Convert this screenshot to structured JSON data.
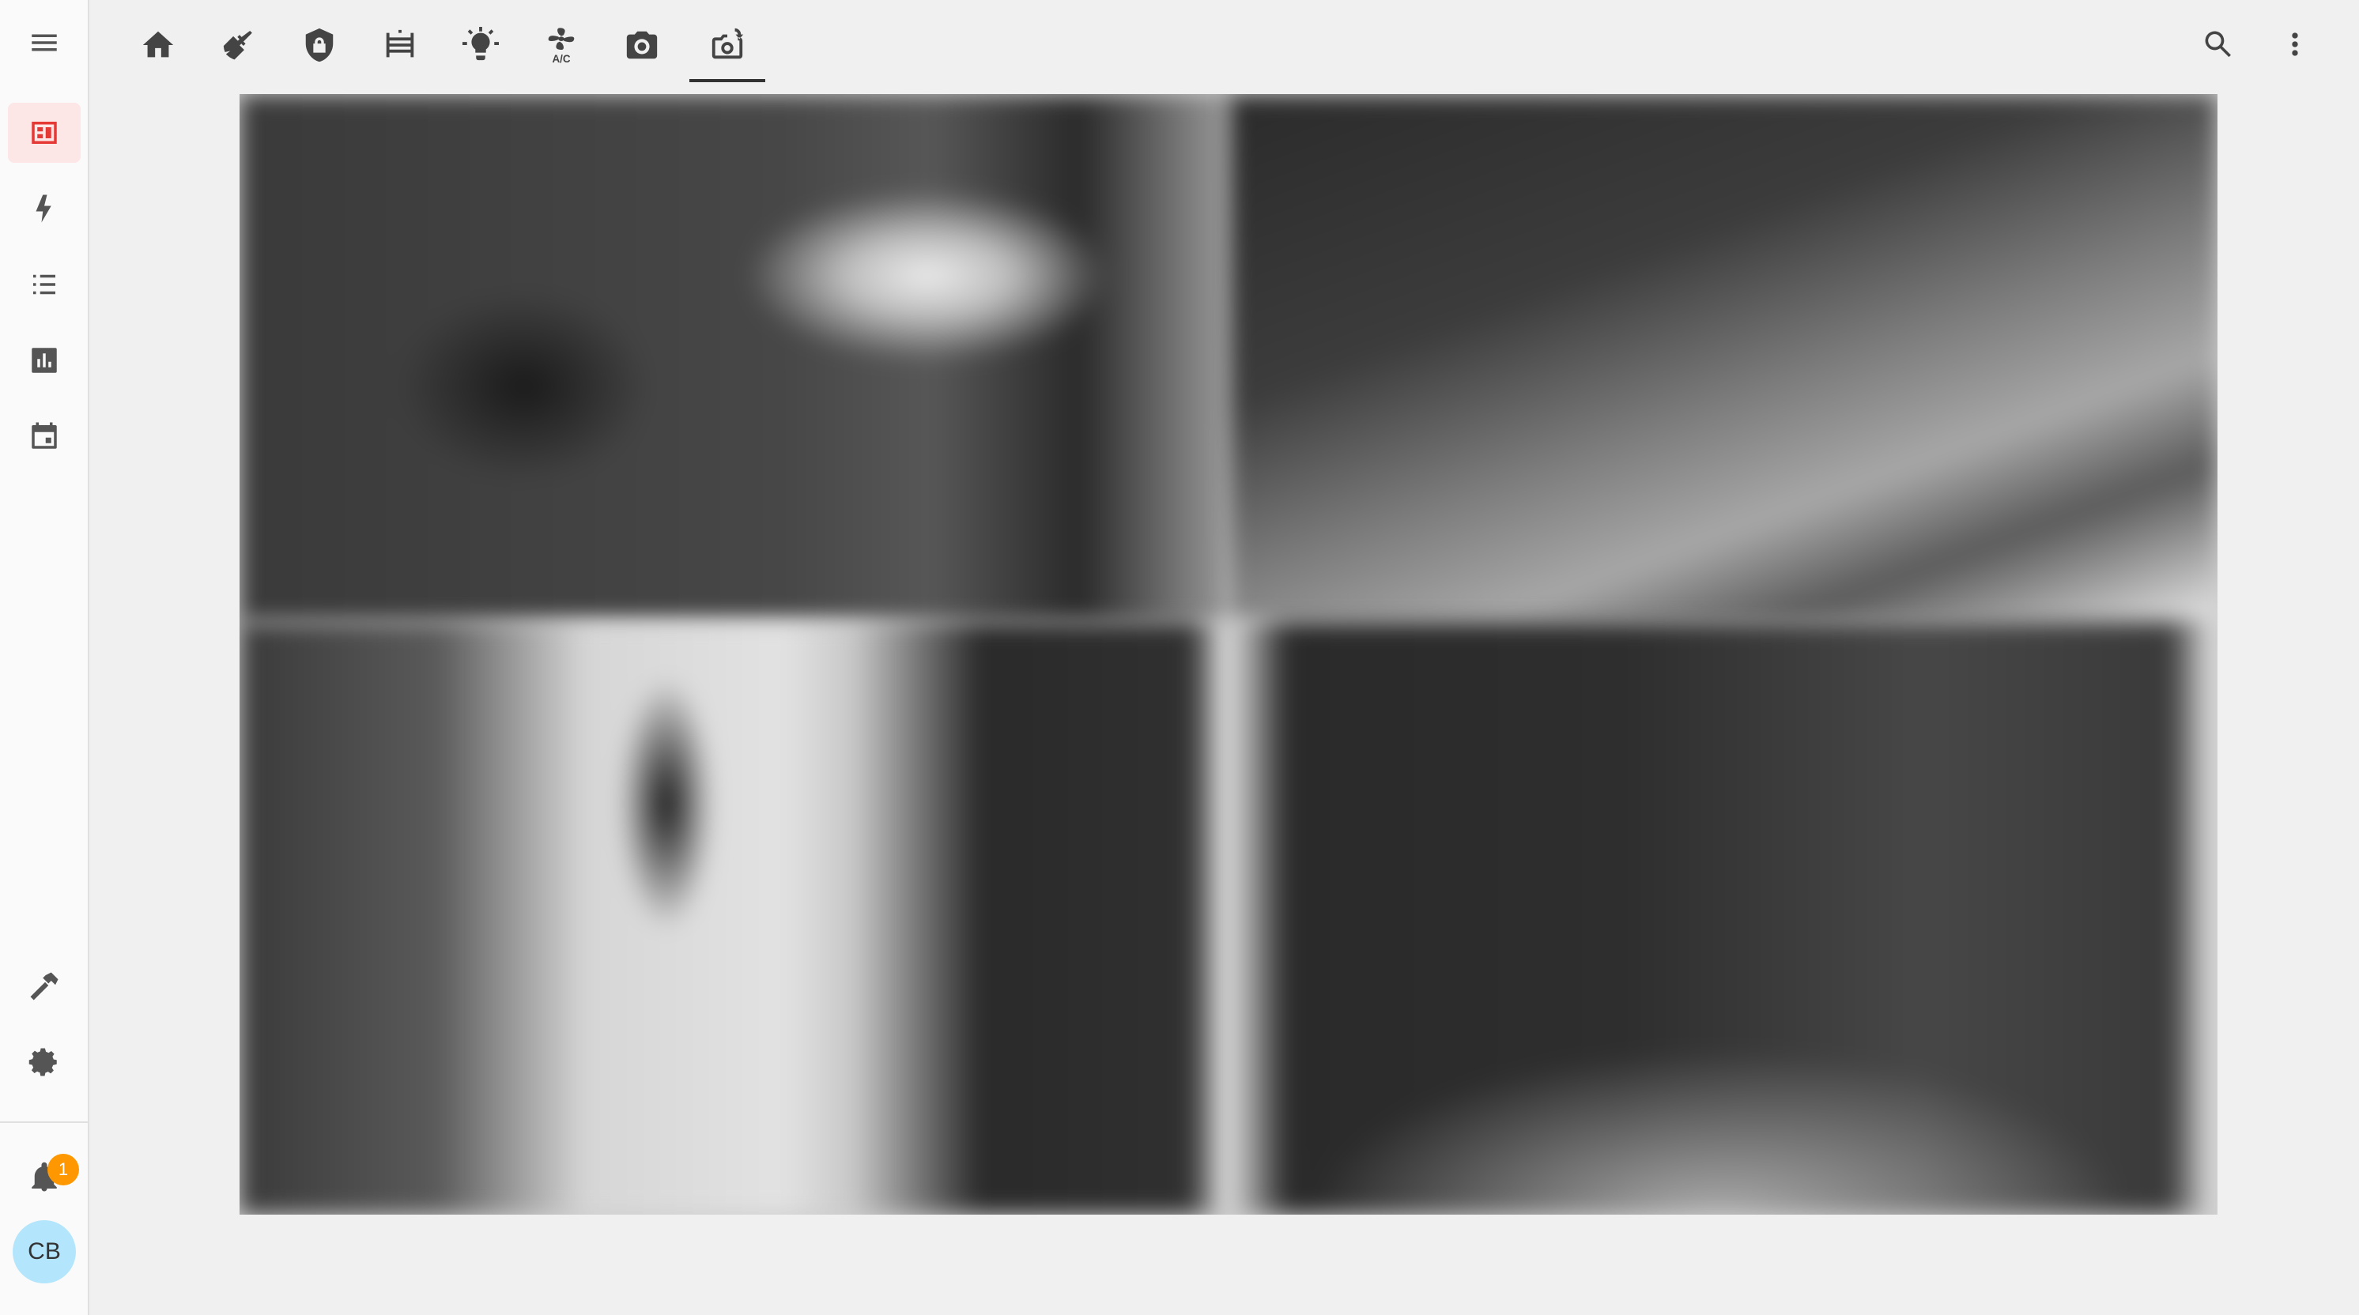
{
  "sidebar": {
    "menu_icon": "menu-icon",
    "items": [
      {
        "name": "overview",
        "icon": "view-dashboard-icon",
        "active": true
      },
      {
        "name": "energy",
        "icon": "lightning-bolt-icon"
      },
      {
        "name": "logbook",
        "icon": "format-list-bulleted-icon"
      },
      {
        "name": "history",
        "icon": "chart-box-icon"
      },
      {
        "name": "calendar",
        "icon": "calendar-icon"
      }
    ],
    "bottom": [
      {
        "name": "developer-tools",
        "icon": "hammer-icon"
      },
      {
        "name": "settings",
        "icon": "cog-icon"
      }
    ],
    "notifications": {
      "icon": "bell-icon",
      "count": "1"
    },
    "user": {
      "initials": "CB"
    }
  },
  "tabs": [
    {
      "name": "home",
      "icon": "home-icon"
    },
    {
      "name": "cleaning",
      "icon": "broom-icon"
    },
    {
      "name": "security",
      "icon": "shield-lock-icon"
    },
    {
      "name": "gate",
      "icon": "gate-icon"
    },
    {
      "name": "lights",
      "icon": "lightbulb-icon"
    },
    {
      "name": "air-conditioning",
      "icon": "fan-ac-icon"
    },
    {
      "name": "camera",
      "icon": "camera-icon"
    },
    {
      "name": "cameras",
      "icon": "camera-switch-icon",
      "active": true
    }
  ],
  "toolbar": {
    "search_icon": "search-icon",
    "menu_icon": "dots-vertical-icon"
  },
  "colors": {
    "accent": "#e53935",
    "badge": "#ff9800",
    "avatar_bg": "#b3e5fc"
  }
}
